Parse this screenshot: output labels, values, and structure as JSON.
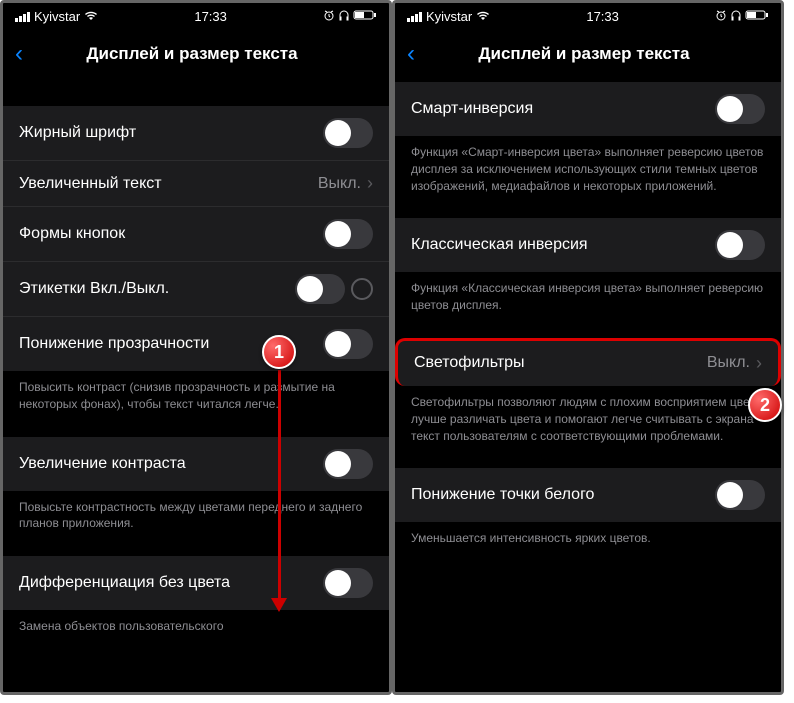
{
  "status": {
    "carrier": "Kyivstar",
    "time": "17:33"
  },
  "header": {
    "title": "Дисплей и размер текста"
  },
  "left": {
    "bold_text": "Жирный шрифт",
    "larger_text": "Увеличенный текст",
    "larger_text_value": "Выкл.",
    "button_shapes": "Формы кнопок",
    "onoff_labels": "Этикетки Вкл./Выкл.",
    "reduce_transparency": "Понижение прозрачности",
    "reduce_transparency_footer": "Повысить контраст (снизив прозрачность и размытие на некоторых фонах), чтобы текст читался легче.",
    "increase_contrast": "Увеличение контраста",
    "increase_contrast_footer": "Повысьте контрастность между цветами переднего и заднего планов приложения.",
    "differentiate": "Дифференциация без цвета",
    "differentiate_footer": "Замена объектов пользовательского"
  },
  "right": {
    "smart_invert": "Смарт-инверсия",
    "smart_invert_footer": "Функция «Смарт-инверсия цвета» выполняет реверсию цветов дисплея за исключением использующих стили темных цветов изображений, медиафайлов и некоторых приложений.",
    "classic_invert": "Классическая инверсия",
    "classic_invert_footer": "Функция «Классическая инверсия цвета» выполняет реверсию цветов дисплея.",
    "color_filters": "Светофильтры",
    "color_filters_value": "Выкл.",
    "color_filters_footer": "Светофильтры позволяют людям с плохим восприятием цвета лучше различать цвета и помогают легче считывать с экрана текст пользователям с соответствующими проблемами.",
    "reduce_white": "Понижение точки белого",
    "reduce_white_footer": "Уменьшается интенсивность ярких цветов."
  },
  "markers": {
    "one": "1",
    "two": "2"
  }
}
